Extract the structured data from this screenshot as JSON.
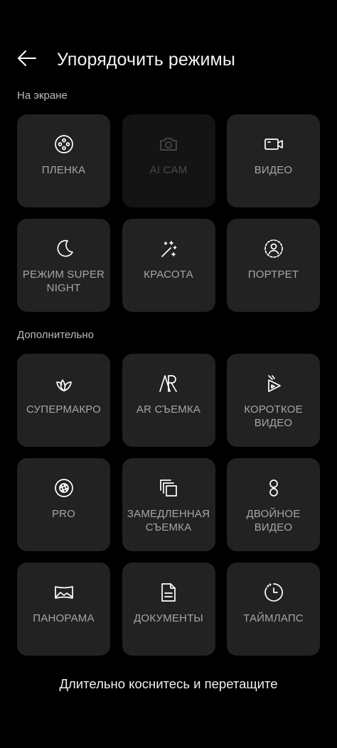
{
  "header": {
    "title": "Упорядочить режимы",
    "back_icon": "arrow-left-icon"
  },
  "sections": {
    "on_screen": {
      "label": "На экране",
      "tiles": [
        {
          "label": "ПЛЕНКА",
          "icon": "film-reel-icon",
          "enabled": true
        },
        {
          "label": "AI CAM",
          "icon": "camera-icon",
          "enabled": false
        },
        {
          "label": "ВИДЕО",
          "icon": "video-camera-icon",
          "enabled": true
        },
        {
          "label": "РЕЖИМ SUPER NIGHT",
          "icon": "moon-icon",
          "enabled": true
        },
        {
          "label": "КРАСОТА",
          "icon": "magic-wand-icon",
          "enabled": true
        },
        {
          "label": "ПОРТРЕТ",
          "icon": "portrait-icon",
          "enabled": true
        }
      ]
    },
    "additional": {
      "label": "Дополнительно",
      "tiles": [
        {
          "label": "СУПЕРМАКРО",
          "icon": "leaf-icon",
          "enabled": true
        },
        {
          "label": "AR СЪЕМКА",
          "icon": "ar-icon",
          "enabled": true
        },
        {
          "label": "КОРОТКОЕ ВИДЕО",
          "icon": "short-video-icon",
          "enabled": true
        },
        {
          "label": "PRO",
          "icon": "aperture-icon",
          "enabled": true
        },
        {
          "label": "ЗАМЕДЛЕННАЯ СЪЕМКА",
          "icon": "slow-motion-icon",
          "enabled": true
        },
        {
          "label": "ДВОЙНОЕ ВИДЕО",
          "icon": "dual-video-icon",
          "enabled": true
        },
        {
          "label": "ПАНОРАМА",
          "icon": "panorama-icon",
          "enabled": true
        },
        {
          "label": "ДОКУМЕНТЫ",
          "icon": "document-icon",
          "enabled": true
        },
        {
          "label": "ТАЙМЛАПС",
          "icon": "timelapse-icon",
          "enabled": true
        }
      ]
    }
  },
  "hint": "Длительно коснитесь и перетащите"
}
